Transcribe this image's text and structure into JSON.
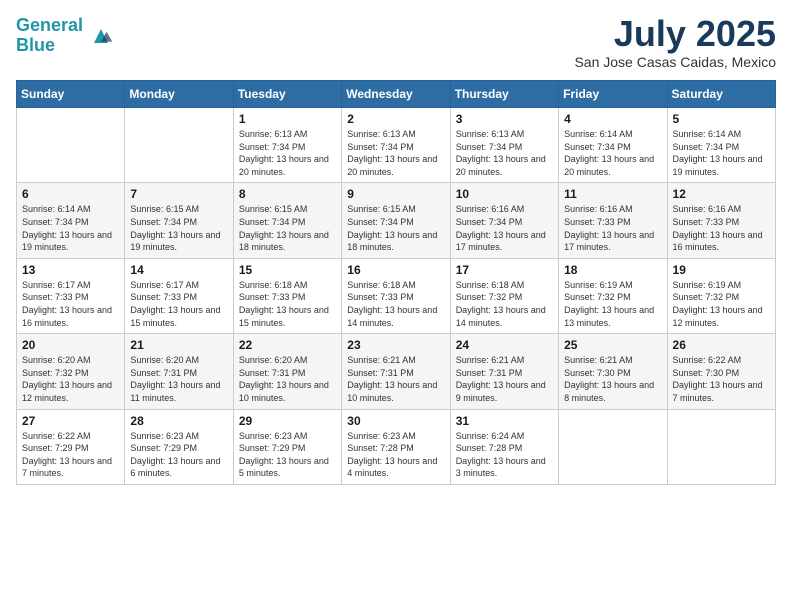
{
  "header": {
    "logo_line1": "General",
    "logo_line2": "Blue",
    "month_year": "July 2025",
    "location": "San Jose Casas Caidas, Mexico"
  },
  "weekdays": [
    "Sunday",
    "Monday",
    "Tuesday",
    "Wednesday",
    "Thursday",
    "Friday",
    "Saturday"
  ],
  "weeks": [
    [
      {
        "day": "",
        "info": ""
      },
      {
        "day": "",
        "info": ""
      },
      {
        "day": "1",
        "info": "Sunrise: 6:13 AM\nSunset: 7:34 PM\nDaylight: 13 hours and 20 minutes."
      },
      {
        "day": "2",
        "info": "Sunrise: 6:13 AM\nSunset: 7:34 PM\nDaylight: 13 hours and 20 minutes."
      },
      {
        "day": "3",
        "info": "Sunrise: 6:13 AM\nSunset: 7:34 PM\nDaylight: 13 hours and 20 minutes."
      },
      {
        "day": "4",
        "info": "Sunrise: 6:14 AM\nSunset: 7:34 PM\nDaylight: 13 hours and 20 minutes."
      },
      {
        "day": "5",
        "info": "Sunrise: 6:14 AM\nSunset: 7:34 PM\nDaylight: 13 hours and 19 minutes."
      }
    ],
    [
      {
        "day": "6",
        "info": "Sunrise: 6:14 AM\nSunset: 7:34 PM\nDaylight: 13 hours and 19 minutes."
      },
      {
        "day": "7",
        "info": "Sunrise: 6:15 AM\nSunset: 7:34 PM\nDaylight: 13 hours and 19 minutes."
      },
      {
        "day": "8",
        "info": "Sunrise: 6:15 AM\nSunset: 7:34 PM\nDaylight: 13 hours and 18 minutes."
      },
      {
        "day": "9",
        "info": "Sunrise: 6:15 AM\nSunset: 7:34 PM\nDaylight: 13 hours and 18 minutes."
      },
      {
        "day": "10",
        "info": "Sunrise: 6:16 AM\nSunset: 7:34 PM\nDaylight: 13 hours and 17 minutes."
      },
      {
        "day": "11",
        "info": "Sunrise: 6:16 AM\nSunset: 7:33 PM\nDaylight: 13 hours and 17 minutes."
      },
      {
        "day": "12",
        "info": "Sunrise: 6:16 AM\nSunset: 7:33 PM\nDaylight: 13 hours and 16 minutes."
      }
    ],
    [
      {
        "day": "13",
        "info": "Sunrise: 6:17 AM\nSunset: 7:33 PM\nDaylight: 13 hours and 16 minutes."
      },
      {
        "day": "14",
        "info": "Sunrise: 6:17 AM\nSunset: 7:33 PM\nDaylight: 13 hours and 15 minutes."
      },
      {
        "day": "15",
        "info": "Sunrise: 6:18 AM\nSunset: 7:33 PM\nDaylight: 13 hours and 15 minutes."
      },
      {
        "day": "16",
        "info": "Sunrise: 6:18 AM\nSunset: 7:33 PM\nDaylight: 13 hours and 14 minutes."
      },
      {
        "day": "17",
        "info": "Sunrise: 6:18 AM\nSunset: 7:32 PM\nDaylight: 13 hours and 14 minutes."
      },
      {
        "day": "18",
        "info": "Sunrise: 6:19 AM\nSunset: 7:32 PM\nDaylight: 13 hours and 13 minutes."
      },
      {
        "day": "19",
        "info": "Sunrise: 6:19 AM\nSunset: 7:32 PM\nDaylight: 13 hours and 12 minutes."
      }
    ],
    [
      {
        "day": "20",
        "info": "Sunrise: 6:20 AM\nSunset: 7:32 PM\nDaylight: 13 hours and 12 minutes."
      },
      {
        "day": "21",
        "info": "Sunrise: 6:20 AM\nSunset: 7:31 PM\nDaylight: 13 hours and 11 minutes."
      },
      {
        "day": "22",
        "info": "Sunrise: 6:20 AM\nSunset: 7:31 PM\nDaylight: 13 hours and 10 minutes."
      },
      {
        "day": "23",
        "info": "Sunrise: 6:21 AM\nSunset: 7:31 PM\nDaylight: 13 hours and 10 minutes."
      },
      {
        "day": "24",
        "info": "Sunrise: 6:21 AM\nSunset: 7:31 PM\nDaylight: 13 hours and 9 minutes."
      },
      {
        "day": "25",
        "info": "Sunrise: 6:21 AM\nSunset: 7:30 PM\nDaylight: 13 hours and 8 minutes."
      },
      {
        "day": "26",
        "info": "Sunrise: 6:22 AM\nSunset: 7:30 PM\nDaylight: 13 hours and 7 minutes."
      }
    ],
    [
      {
        "day": "27",
        "info": "Sunrise: 6:22 AM\nSunset: 7:29 PM\nDaylight: 13 hours and 7 minutes."
      },
      {
        "day": "28",
        "info": "Sunrise: 6:23 AM\nSunset: 7:29 PM\nDaylight: 13 hours and 6 minutes."
      },
      {
        "day": "29",
        "info": "Sunrise: 6:23 AM\nSunset: 7:29 PM\nDaylight: 13 hours and 5 minutes."
      },
      {
        "day": "30",
        "info": "Sunrise: 6:23 AM\nSunset: 7:28 PM\nDaylight: 13 hours and 4 minutes."
      },
      {
        "day": "31",
        "info": "Sunrise: 6:24 AM\nSunset: 7:28 PM\nDaylight: 13 hours and 3 minutes."
      },
      {
        "day": "",
        "info": ""
      },
      {
        "day": "",
        "info": ""
      }
    ]
  ]
}
